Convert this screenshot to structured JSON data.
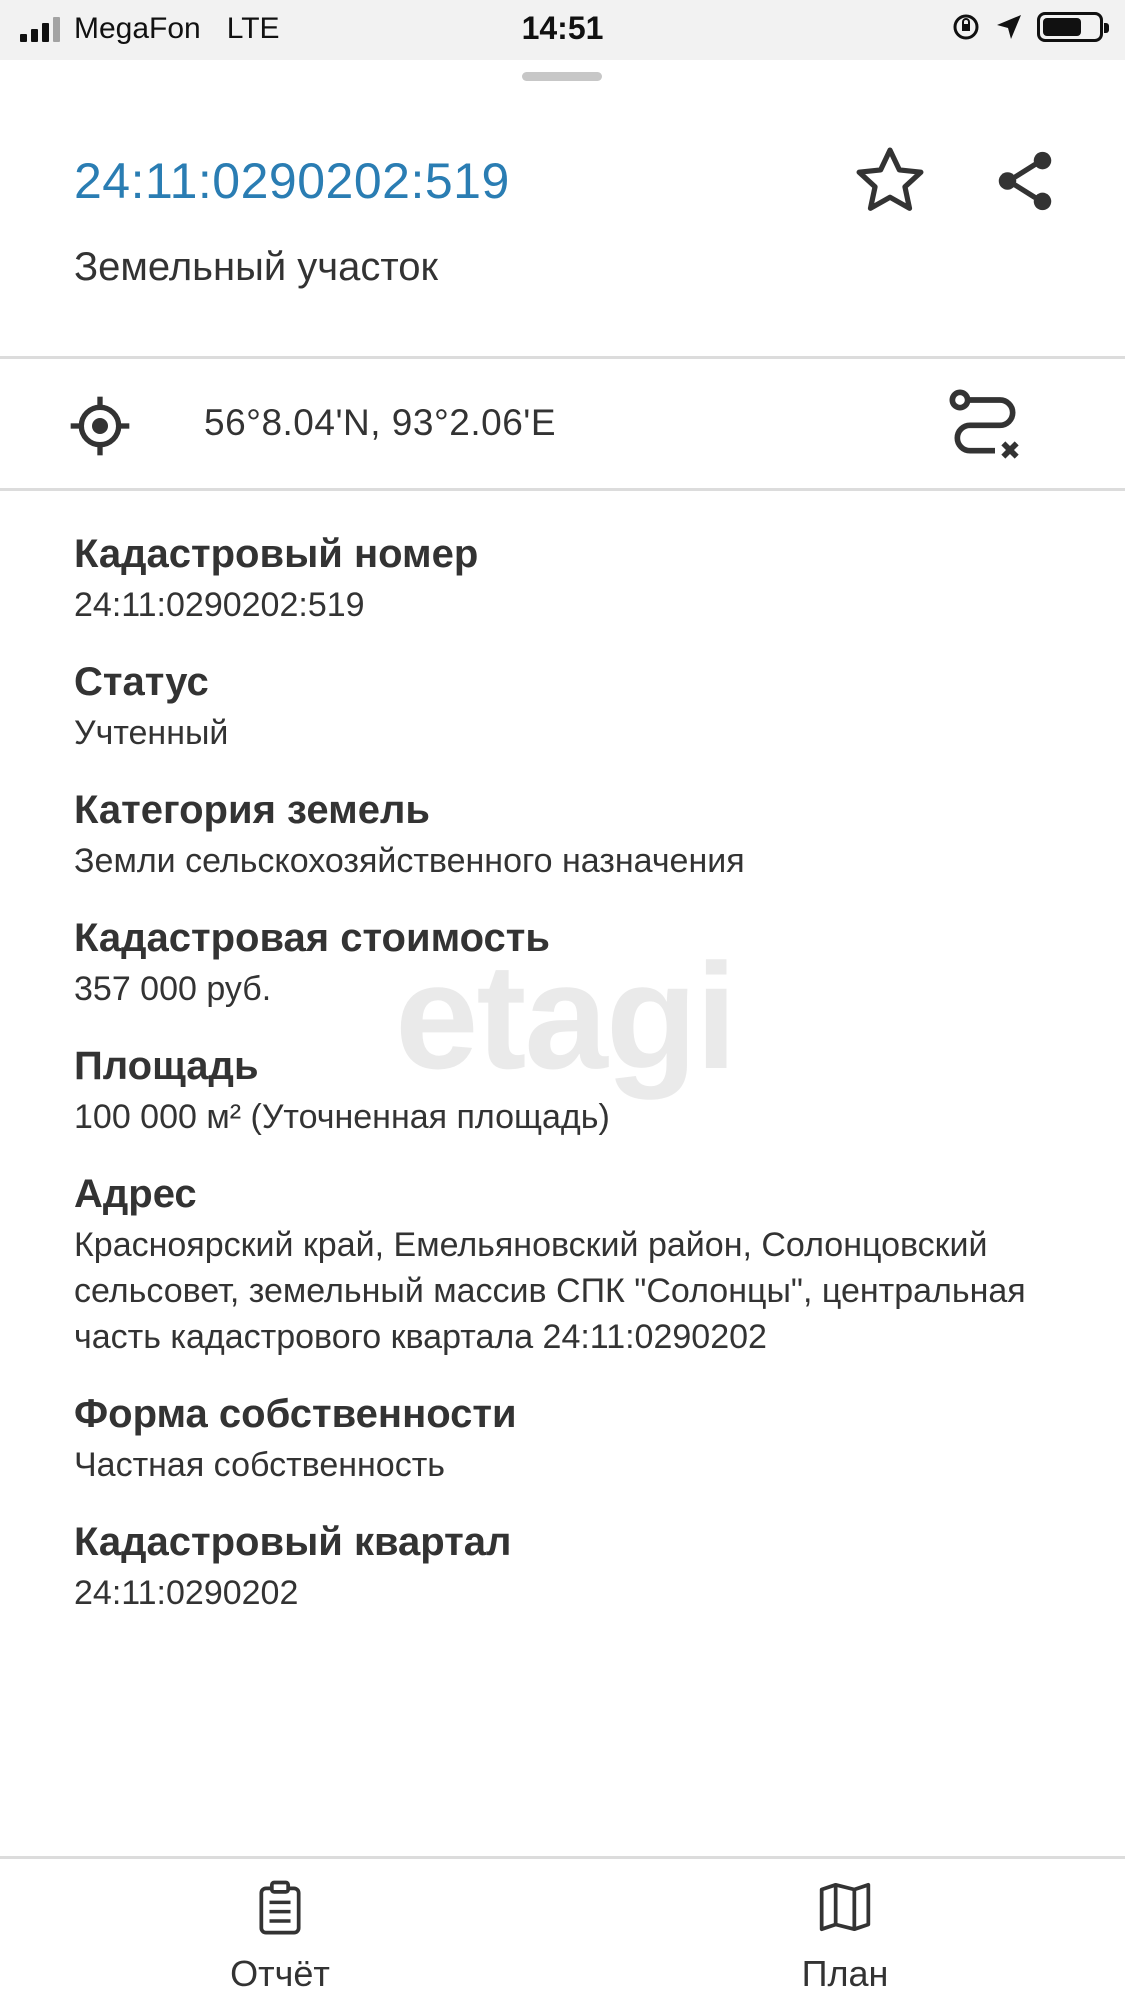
{
  "status_bar": {
    "carrier": "MegaFon",
    "network": "LTE",
    "time": "14:51"
  },
  "header": {
    "title": "24:11:0290202:519",
    "subtitle": "Земельный участок"
  },
  "location": {
    "coordinates": "56°8.04'N, 93°2.06'E"
  },
  "properties": [
    {
      "label": "Кадастровый номер",
      "value": "24:11:0290202:519"
    },
    {
      "label": "Статус",
      "value": "Учтенный"
    },
    {
      "label": "Категория земель",
      "value": "Земли сельскохозяйственного назначения"
    },
    {
      "label": "Кадастровая стоимость",
      "value": "357 000 руб."
    },
    {
      "label": "Площадь",
      "value": "100 000 м² (Уточненная площадь)"
    },
    {
      "label": "Адрес",
      "value": "Красноярский край, Емельяновский район, Солонцовский сельсовет, земельный массив СПК \"Солонцы\", центральная часть кадастрового квартала 24:11:0290202"
    },
    {
      "label": "Форма собственности",
      "value": "Частная собственность"
    },
    {
      "label": "Кадастровый квартал",
      "value": "24:11:0290202"
    }
  ],
  "watermark": "etagi",
  "tabs": {
    "report": "Отчёт",
    "plan": "План"
  },
  "icons": {
    "favorite": "star-icon",
    "share": "share-icon",
    "location": "target-icon",
    "route": "route-icon",
    "report": "clipboard-icon",
    "plan": "map-icon"
  },
  "colors": {
    "accent": "#2a7db3",
    "divider": "#dcdcdc",
    "status_bar_bg": "#f2f2f2"
  }
}
